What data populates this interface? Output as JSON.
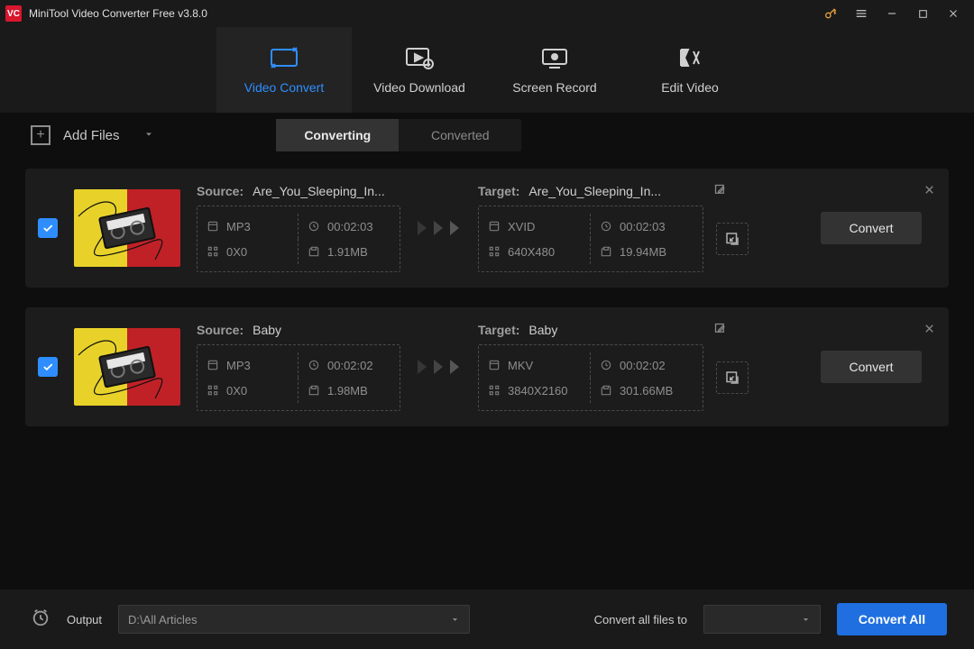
{
  "app": {
    "title": "MiniTool Video Converter Free v3.8.0"
  },
  "nav": {
    "video_convert": "Video Convert",
    "video_download": "Video Download",
    "screen_record": "Screen Record",
    "edit_video": "Edit Video"
  },
  "toolbar": {
    "add_files": "Add Files",
    "subtab_converting": "Converting",
    "subtab_converted": "Converted"
  },
  "labels": {
    "source": "Source:",
    "target": "Target:"
  },
  "items": [
    {
      "source_name": "Are_You_Sleeping_In...",
      "source": {
        "format": "MP3",
        "duration": "00:02:03",
        "resolution": "0X0",
        "size": "1.91MB"
      },
      "target_name": "Are_You_Sleeping_In...",
      "target": {
        "format": "XVID",
        "duration": "00:02:03",
        "resolution": "640X480",
        "size": "19.94MB"
      },
      "convert_label": "Convert"
    },
    {
      "source_name": "Baby",
      "source": {
        "format": "MP3",
        "duration": "00:02:02",
        "resolution": "0X0",
        "size": "1.98MB"
      },
      "target_name": "Baby",
      "target": {
        "format": "MKV",
        "duration": "00:02:02",
        "resolution": "3840X2160",
        "size": "301.66MB"
      },
      "convert_label": "Convert"
    }
  ],
  "bottom": {
    "output_label": "Output",
    "output_path": "D:\\All Articles",
    "convert_all_files_to": "Convert all files to",
    "convert_all": "Convert All"
  }
}
